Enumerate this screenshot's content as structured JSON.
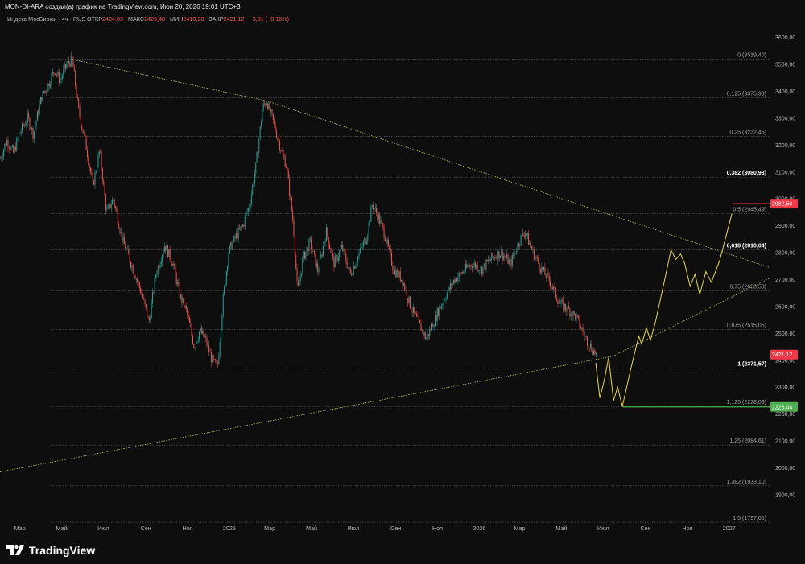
{
  "header": {
    "title": "MON-DI-ARA создал(а) график на TradingView.com, Июн 20, 2026 19:01 UTC+3",
    "symbol": "Индекс МосБиржи · 4ч · RUS",
    "open_label": "ОТКР",
    "open_value": "2424,83",
    "high_label": "МАКС",
    "high_value": "2425,48",
    "low_label": "МИН",
    "low_value": "2410,20",
    "close_label": "ЗАКР",
    "close_value": "2421,12",
    "change_value": "−3,81 (−0,16%)"
  },
  "brand": {
    "name": "TradingView",
    "icon": "tradingview-logo-icon"
  },
  "colors": {
    "background": "#0e0e0e",
    "up": "#26a69a",
    "down": "#ef5350",
    "fib_line": "#5a5a5a",
    "trendline": "#b9b94a",
    "projection": "#e6d84a",
    "target_red": "#f23645",
    "target_green": "#4caf50"
  },
  "chart_data": {
    "type": "candlestick",
    "price_axis": {
      "range": [
        1750,
        3650
      ],
      "ticks": [
        1900,
        2000,
        2100,
        2200,
        2300,
        2400,
        2500,
        2600,
        2700,
        2800,
        2900,
        3000,
        3100,
        3200,
        3300,
        3400,
        3500,
        3600
      ],
      "tick_labels": [
        "1900,00",
        "2000,00",
        "2100,00",
        "2200,00",
        "2300,00",
        "2400,00",
        "2500,00",
        "2600,00",
        "2700,00",
        "2800,00",
        "2900,00",
        "3000,00",
        "3100,00",
        "3200,00",
        "3300,00",
        "3400,00",
        "3500,00",
        "3600,00"
      ]
    },
    "time_axis": {
      "range": [
        "2024-02-01",
        "2027-03-01"
      ],
      "ticks": [
        "2024-03-01",
        "2024-05-01",
        "2024-07-01",
        "2024-09-01",
        "2024-11-01",
        "2025-01-01",
        "2025-03-01",
        "2025-05-01",
        "2025-07-01",
        "2025-09-01",
        "2025-11-01",
        "2026-01-01",
        "2026-03-01",
        "2026-05-01",
        "2026-07-01",
        "2026-09-01",
        "2026-11-01",
        "2027-01-01"
      ],
      "tick_labels": [
        "Мар",
        "Май",
        "Июл",
        "Сен",
        "Ноя",
        "2025",
        "Мар",
        "Май",
        "Июл",
        "Сен",
        "Ноя",
        "2026",
        "Мар",
        "Май",
        "Июл",
        "Сен",
        "Ноя",
        "2027"
      ]
    },
    "price_path": [
      [
        "2024-02-01",
        3150
      ],
      [
        "2024-02-10",
        3220
      ],
      [
        "2024-02-20",
        3170
      ],
      [
        "2024-03-01",
        3250
      ],
      [
        "2024-03-12",
        3300
      ],
      [
        "2024-03-20",
        3240
      ],
      [
        "2024-04-01",
        3380
      ],
      [
        "2024-04-10",
        3420
      ],
      [
        "2024-04-20",
        3480
      ],
      [
        "2024-04-28",
        3440
      ],
      [
        "2024-05-08",
        3500
      ],
      [
        "2024-05-16",
        3519
      ],
      [
        "2024-05-25",
        3330
      ],
      [
        "2024-06-05",
        3200
      ],
      [
        "2024-06-15",
        3050
      ],
      [
        "2024-06-25",
        3180
      ],
      [
        "2024-07-05",
        2950
      ],
      [
        "2024-07-15",
        3000
      ],
      [
        "2024-07-28",
        2850
      ],
      [
        "2024-08-10",
        2760
      ],
      [
        "2024-08-25",
        2650
      ],
      [
        "2024-09-05",
        2540
      ],
      [
        "2024-09-15",
        2720
      ],
      [
        "2024-09-28",
        2830
      ],
      [
        "2024-10-10",
        2760
      ],
      [
        "2024-10-20",
        2640
      ],
      [
        "2024-10-30",
        2580
      ],
      [
        "2024-11-10",
        2450
      ],
      [
        "2024-11-18",
        2510
      ],
      [
        "2024-11-26",
        2480
      ],
      [
        "2024-12-06",
        2400
      ],
      [
        "2024-12-14",
        2372
      ],
      [
        "2024-12-22",
        2620
      ],
      [
        "2024-12-30",
        2800
      ],
      [
        "2025-01-10",
        2860
      ],
      [
        "2025-01-20",
        2900
      ],
      [
        "2025-01-30",
        2980
      ],
      [
        "2025-02-08",
        3120
      ],
      [
        "2025-02-18",
        3340
      ],
      [
        "2025-02-24",
        3365
      ],
      [
        "2025-03-05",
        3290
      ],
      [
        "2025-03-15",
        3200
      ],
      [
        "2025-03-25",
        3120
      ],
      [
        "2025-04-04",
        2900
      ],
      [
        "2025-04-10",
        2650
      ],
      [
        "2025-04-18",
        2780
      ],
      [
        "2025-04-28",
        2840
      ],
      [
        "2025-05-10",
        2730
      ],
      [
        "2025-05-22",
        2880
      ],
      [
        "2025-06-02",
        2760
      ],
      [
        "2025-06-14",
        2820
      ],
      [
        "2025-06-26",
        2720
      ],
      [
        "2025-07-08",
        2790
      ],
      [
        "2025-07-20",
        2860
      ],
      [
        "2025-07-28",
        2980
      ],
      [
        "2025-08-05",
        2940
      ],
      [
        "2025-08-15",
        2870
      ],
      [
        "2025-08-28",
        2740
      ],
      [
        "2025-09-10",
        2700
      ],
      [
        "2025-09-22",
        2600
      ],
      [
        "2025-10-05",
        2530
      ],
      [
        "2025-10-15",
        2480
      ],
      [
        "2025-10-22",
        2520
      ],
      [
        "2025-11-01",
        2580
      ],
      [
        "2025-11-12",
        2640
      ],
      [
        "2025-11-25",
        2700
      ],
      [
        "2025-12-08",
        2730
      ],
      [
        "2025-12-20",
        2760
      ],
      [
        "2026-01-05",
        2740
      ],
      [
        "2026-01-18",
        2780
      ],
      [
        "2026-02-01",
        2800
      ],
      [
        "2026-02-15",
        2760
      ],
      [
        "2026-03-01",
        2850
      ],
      [
        "2026-03-08",
        2880
      ],
      [
        "2026-03-20",
        2800
      ],
      [
        "2026-04-01",
        2740
      ],
      [
        "2026-04-14",
        2690
      ],
      [
        "2026-04-28",
        2610
      ],
      [
        "2026-05-10",
        2590
      ],
      [
        "2026-05-22",
        2560
      ],
      [
        "2026-06-05",
        2480
      ],
      [
        "2026-06-15",
        2440
      ],
      [
        "2026-06-20",
        2421
      ]
    ],
    "fib_levels": [
      {
        "ratio": "0",
        "value": 3519.4,
        "label": "0 (3519,40)",
        "bold": false
      },
      {
        "ratio": "0,125",
        "value": 3375.93,
        "label": "0,125 (3375,93)",
        "bold": false
      },
      {
        "ratio": "0,25",
        "value": 3232.45,
        "label": "0,25 (3232,45)",
        "bold": false
      },
      {
        "ratio": "0,382",
        "value": 3080.93,
        "label": "0,382 (3080,93)",
        "bold": true
      },
      {
        "ratio": "0,5",
        "value": 2945.49,
        "label": "0,5 (2945,49)",
        "bold": false
      },
      {
        "ratio": "0,618",
        "value": 2810.04,
        "label": "0,618 (2810,04)",
        "bold": true
      },
      {
        "ratio": "0,75",
        "value": 2658.53,
        "label": "0,75 (2658,53)",
        "bold": false
      },
      {
        "ratio": "0,875",
        "value": 2515.05,
        "label": "0,875 (2515,05)",
        "bold": false
      },
      {
        "ratio": "1",
        "value": 2371.57,
        "label": "1 (2371,57)",
        "bold": true
      },
      {
        "ratio": "1,125",
        "value": 2228.09,
        "label": "1,125 (2228,09)",
        "bold": false
      },
      {
        "ratio": "1,25",
        "value": 2084.61,
        "label": "1,25 (2084,61)",
        "bold": false
      },
      {
        "ratio": "1,382",
        "value": 1933.1,
        "label": "1,382 (1933,10)",
        "bold": false
      },
      {
        "ratio": "1,5",
        "value": 1797.65,
        "label": "1,5 (1797,65)",
        "bold": false
      }
    ],
    "trendlines": [
      {
        "name": "descending",
        "points": [
          [
            "2024-05-16",
            3519
          ],
          [
            "2025-02-24",
            3365
          ],
          [
            "2027-03-01",
            2745
          ]
        ]
      },
      {
        "name": "ascending",
        "points": [
          [
            "2024-02-01",
            1985
          ],
          [
            "2026-07-15",
            2415
          ],
          [
            "2027-03-01",
            2705
          ]
        ]
      }
    ],
    "projection_path": [
      [
        "2026-06-20",
        2390
      ],
      [
        "2026-06-26",
        2260
      ],
      [
        "2026-07-02",
        2320
      ],
      [
        "2026-07-09",
        2410
      ],
      [
        "2026-07-16",
        2250
      ],
      [
        "2026-07-22",
        2300
      ],
      [
        "2026-07-29",
        2228
      ],
      [
        "2026-08-10",
        2365
      ],
      [
        "2026-08-22",
        2490
      ],
      [
        "2026-08-26",
        2460
      ],
      [
        "2026-09-02",
        2520
      ],
      [
        "2026-09-08",
        2475
      ],
      [
        "2026-09-15",
        2540
      ],
      [
        "2026-09-28",
        2690
      ],
      [
        "2026-10-08",
        2810
      ],
      [
        "2026-10-15",
        2775
      ],
      [
        "2026-10-22",
        2795
      ],
      [
        "2026-10-28",
        2760
      ],
      [
        "2026-11-05",
        2675
      ],
      [
        "2026-11-12",
        2720
      ],
      [
        "2026-11-19",
        2645
      ],
      [
        "2026-11-28",
        2730
      ],
      [
        "2026-12-06",
        2690
      ],
      [
        "2026-12-18",
        2770
      ],
      [
        "2027-01-05",
        2945
      ]
    ],
    "target_lines": [
      {
        "label": "2982,50",
        "value": 2982.5,
        "color": "red",
        "from": "2027-01-05",
        "to": "2027-03-01"
      },
      {
        "label": "2226,44",
        "value": 2226.44,
        "color": "green",
        "from": "2026-07-29",
        "to": "2027-03-01"
      }
    ],
    "current_price": {
      "label": "2421,12",
      "value": 2421.12
    }
  }
}
